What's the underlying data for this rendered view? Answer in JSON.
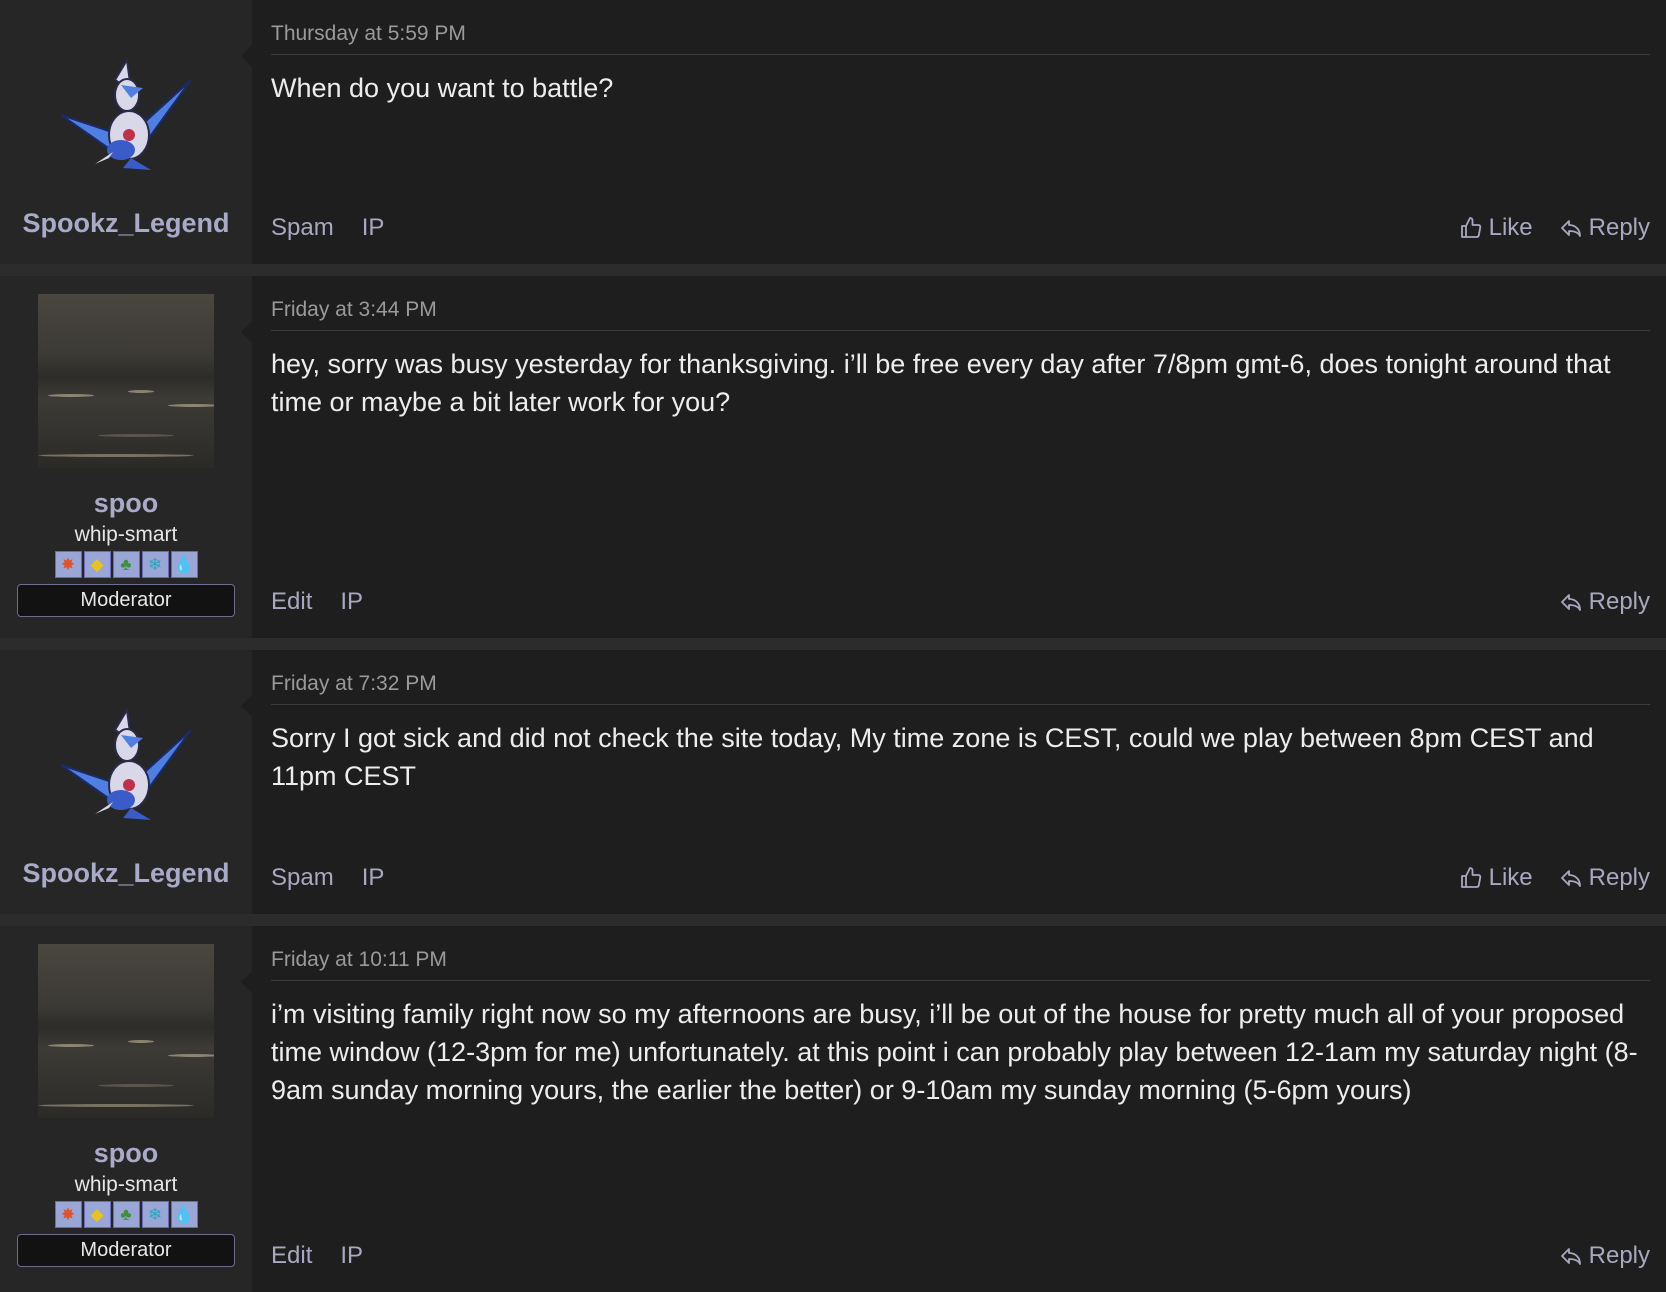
{
  "posts": [
    {
      "username": "Spookz_Legend",
      "user_title": "",
      "role": "",
      "avatar": "latios-sprite",
      "timestamp": "Thursday at 5:59 PM",
      "message": "When do you want to battle?",
      "actions_left": [
        "Spam",
        "IP"
      ],
      "like_label": "Like",
      "reply_label": "Reply"
    },
    {
      "username": "spoo",
      "user_title": "whip-smart",
      "role": "Moderator",
      "avatar": "ocean-waves-photo",
      "timestamp": "Friday at 3:44 PM",
      "message": "hey, sorry was busy yesterday for thanksgiving. i’ll be free every day after 7/8pm gmt-6, does tonight around that time or maybe a bit later work for you?",
      "actions_left": [
        "Edit",
        "IP"
      ],
      "like_label": "",
      "reply_label": "Reply"
    },
    {
      "username": "Spookz_Legend",
      "user_title": "",
      "role": "",
      "avatar": "latios-sprite",
      "timestamp": "Friday at 7:32 PM",
      "message": "Sorry I got sick and did not check the site today, My time zone is CEST, could we play between 8pm CEST and 11pm CEST",
      "actions_left": [
        "Spam",
        "IP"
      ],
      "like_label": "Like",
      "reply_label": "Reply"
    },
    {
      "username": "spoo",
      "user_title": "whip-smart",
      "role": "Moderator",
      "avatar": "ocean-waves-photo",
      "timestamp": "Friday at 10:11 PM",
      "message": "i’m visiting family right now so my afternoons are busy, i’ll be out of the house for pretty much all of your proposed time window (12-3pm for me) unfortunately. at this point i can probably play between 12-1am my saturday night (8-9am sunday morning yours, the earlier the better) or 9-10am my sunday morning (5-6pm yours)",
      "actions_left": [
        "Edit",
        "IP"
      ],
      "like_label": "",
      "reply_label": "Reply"
    }
  ],
  "type_badges": [
    {
      "icon": "fire-type-icon",
      "glyph": "✸",
      "color": "#e0522a"
    },
    {
      "icon": "electric-type-icon",
      "glyph": "◆",
      "color": "#e8c21e"
    },
    {
      "icon": "grass-type-icon",
      "glyph": "♣",
      "color": "#4aa84a"
    },
    {
      "icon": "ice-type-icon",
      "glyph": "❄",
      "color": "#3ec0d8"
    },
    {
      "icon": "water-type-icon",
      "glyph": "💧",
      "color": "#3a74d8"
    }
  ],
  "colors": {
    "background": "#1e1e1e",
    "user_panel": "#262626",
    "separator": "#2c2c2c",
    "username": "#a9a9c8",
    "action_text": "#a8a8c0"
  }
}
